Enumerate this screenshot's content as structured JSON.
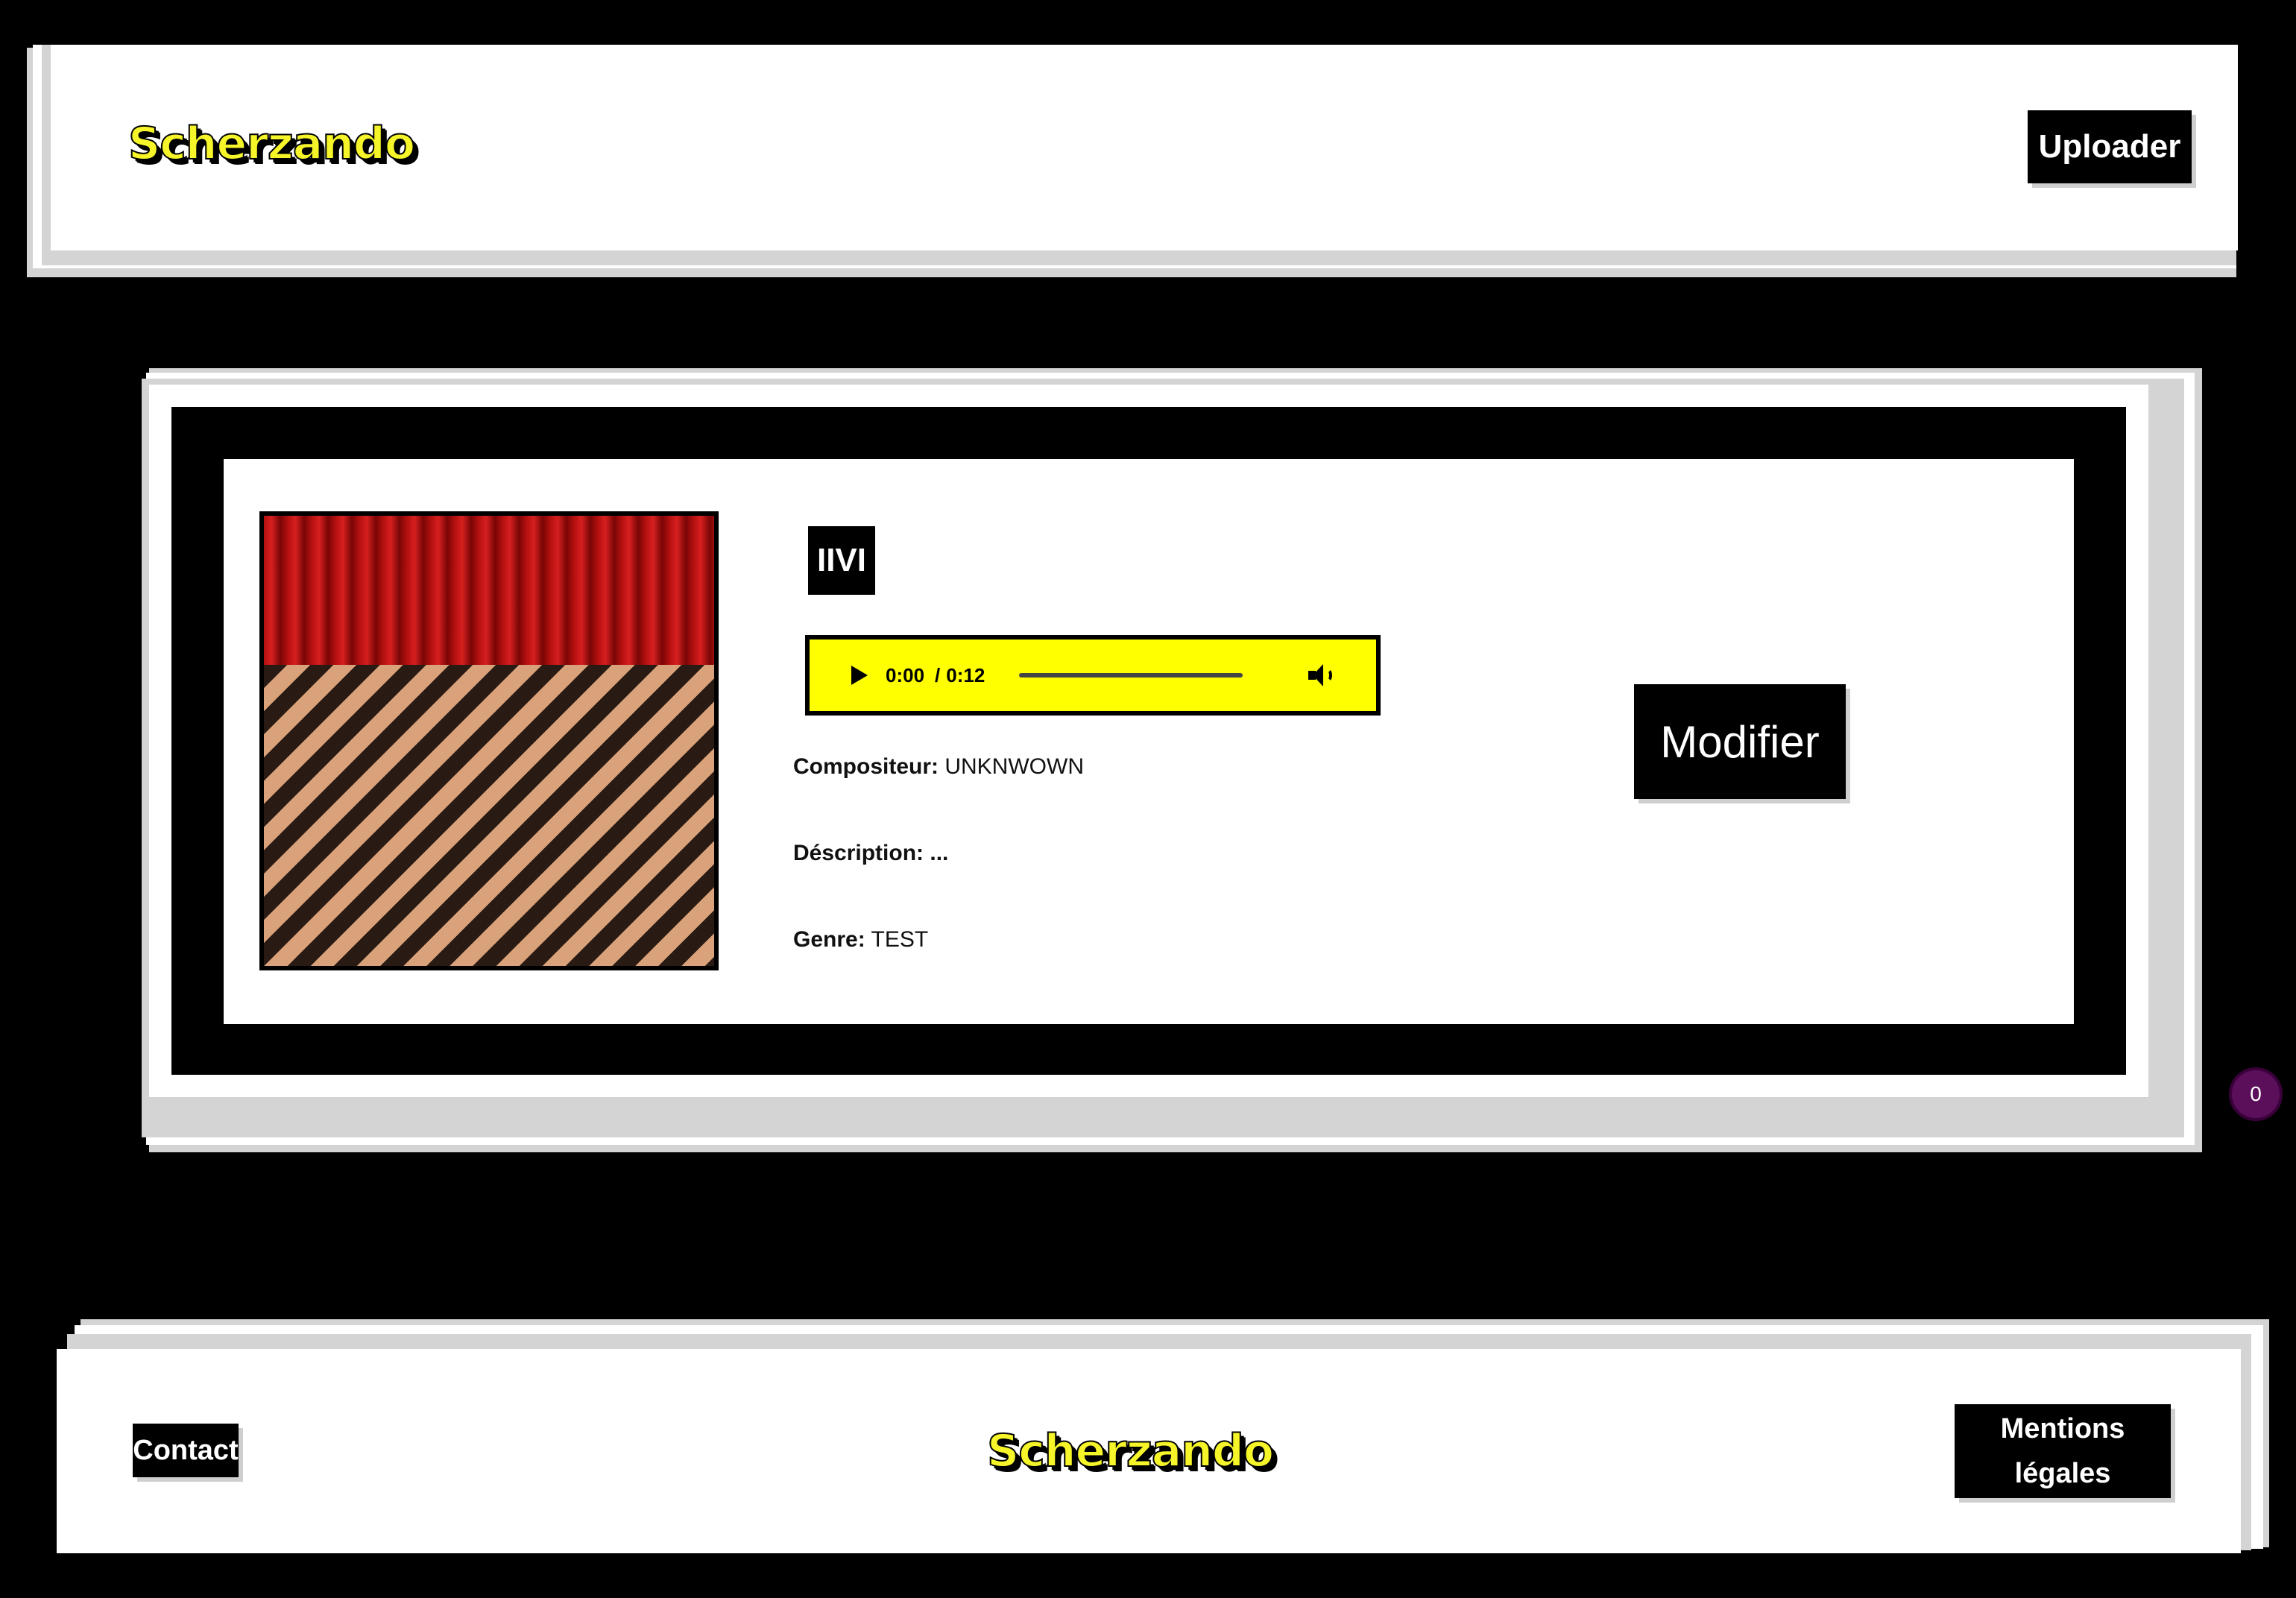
{
  "header": {
    "logo_text": "Scherzando",
    "upload_label": "Uploader"
  },
  "track": {
    "title": "IIVI",
    "player": {
      "current_time": "0:00",
      "separator": "/",
      "duration": "0:12",
      "progress": 0
    },
    "composer_label": "Compositeur:",
    "composer_value": "UNKNWOWN",
    "description_label": "Déscription:",
    "description_value": "...",
    "genre_label": "Genre:",
    "genre_value": "TEST",
    "edit_label": "Modifier",
    "cover_icon": "red-room-cover-image"
  },
  "badge": {
    "count": "0"
  },
  "footer": {
    "contact_label": "Contact",
    "logo_text": "Scherzando",
    "legal_label_line1": "Mentions",
    "legal_label_line2": "légales"
  },
  "colors": {
    "background": "#000000",
    "accent_yellow": "#ffff00",
    "card": "#ffffff",
    "badge": "#5b0f5b"
  }
}
